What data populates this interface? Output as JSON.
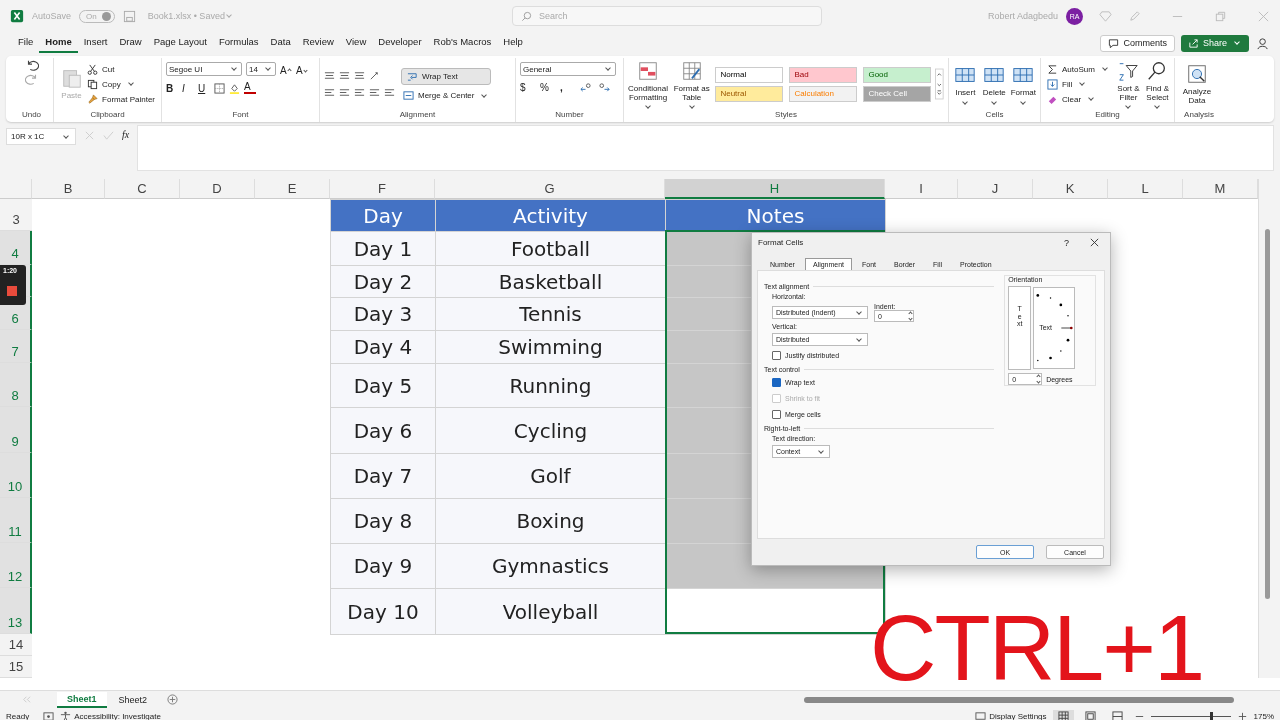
{
  "title_bar": {
    "autosave_label": "AutoSave",
    "autosave_toggle": {
      "label": "On",
      "on": true
    },
    "document": "Book1.xlsx • Saved",
    "search": {
      "placeholder": "Search"
    },
    "user_name": "Robert Adagbedu",
    "avatar": "RA"
  },
  "menu_tabs": [
    {
      "label": "File",
      "selected": false
    },
    {
      "label": "Home",
      "selected": true
    },
    {
      "label": "Insert",
      "selected": false
    },
    {
      "label": "Draw",
      "selected": false
    },
    {
      "label": "Page Layout",
      "selected": false
    },
    {
      "label": "Formulas",
      "selected": false
    },
    {
      "label": "Data",
      "selected": false
    },
    {
      "label": "Review",
      "selected": false
    },
    {
      "label": "View",
      "selected": false
    },
    {
      "label": "Developer",
      "selected": false
    },
    {
      "label": "Rob's Macros",
      "selected": false
    },
    {
      "label": "Help",
      "selected": false
    }
  ],
  "comments_button": "Comments",
  "share_button": "Share",
  "ribbon": {
    "undo_label": "Undo",
    "clipboard": {
      "paste": "Paste",
      "cut": "Cut",
      "copy": "Copy",
      "format_painter": "Format Painter",
      "label": "Clipboard"
    },
    "font": {
      "family": "Segoe UI",
      "size": "14",
      "grow": "A",
      "shrink": "A",
      "bold": "B",
      "italic": "I",
      "underline": "U",
      "font_color": "A",
      "label": "Font"
    },
    "alignment": {
      "wrap_text": {
        "label": "Wrap Text",
        "on": true
      },
      "merge": "Merge & Center",
      "label": "Alignment"
    },
    "number": {
      "format": "General",
      "currency": "$",
      "percent": "%",
      "comma": ",",
      "label": "Number"
    },
    "styles": {
      "conditional": "Conditional Formatting",
      "format_table": "Format as Table",
      "label": "Styles",
      "gallery": [
        {
          "label": "Normal",
          "color": "#ffffff"
        },
        {
          "label": "Bad",
          "color": "#ffc7ce"
        },
        {
          "label": "Good",
          "color": "#c6efce"
        },
        {
          "label": "Neutral",
          "color": "#ffeb9c"
        },
        {
          "label": "Calculation",
          "color": "#f2f2f2"
        },
        {
          "label": "Check Cell",
          "color": "#a5a5a5"
        }
      ]
    },
    "cells": {
      "buttons": [
        "Insert",
        "Delete",
        "Format"
      ],
      "label": "Cells"
    },
    "editing": {
      "autosum": "AutoSum",
      "fill": "Fill",
      "clear": "Clear",
      "sort": "Sort & Filter",
      "find": "Find & Select",
      "label": "Editing"
    },
    "analysis": {
      "analyze": "Analyze Data",
      "label": "Analysis"
    }
  },
  "formula_bar": {
    "name_box": "10R x 1C",
    "fx": "fx"
  },
  "sheet": {
    "columns": [
      {
        "label": "B",
        "selected": false
      },
      {
        "label": "C",
        "selected": false
      },
      {
        "label": "D",
        "selected": false
      },
      {
        "label": "E",
        "selected": false
      },
      {
        "label": "F",
        "selected": false
      },
      {
        "label": "G",
        "selected": false
      },
      {
        "label": "H",
        "selected": true
      },
      {
        "label": "I",
        "selected": false
      },
      {
        "label": "J",
        "selected": false
      },
      {
        "label": "K",
        "selected": false
      },
      {
        "label": "L",
        "selected": false
      },
      {
        "label": "M",
        "selected": false
      }
    ],
    "row_numbers": [
      {
        "label": "3",
        "selected": false
      },
      {
        "label": "4",
        "selected": true
      },
      {
        "selected": true
      },
      {
        "label": "6",
        "selected": true
      },
      {
        "label": "7",
        "selected": true
      },
      {
        "label": "8",
        "selected": true
      },
      {
        "label": "9",
        "selected": true
      },
      {
        "label": "10",
        "selected": true
      },
      {
        "label": "11",
        "selected": true
      },
      {
        "label": "12",
        "selected": true
      },
      {
        "label": "13",
        "selected": true
      },
      {
        "label": "14",
        "selected": false
      },
      {
        "label": "15",
        "selected": false
      }
    ],
    "headers": [
      "Day",
      "Activity",
      "Notes"
    ],
    "rows": [
      {
        "day": "Day 1",
        "activity": "Football",
        "active": false
      },
      {
        "day": "Day 2",
        "activity": "Basketball",
        "active": false
      },
      {
        "day": "Day 3",
        "activity": "Tennis",
        "active": false
      },
      {
        "day": "Day 4",
        "activity": "Swimming",
        "active": false
      },
      {
        "day": "Day 5",
        "activity": "Running",
        "active": false
      },
      {
        "day": "Day 6",
        "activity": "Cycling",
        "active": false
      },
      {
        "day": "Day 7",
        "activity": "Golf",
        "active": false
      },
      {
        "day": "Day 8",
        "activity": "Boxing",
        "active": false
      },
      {
        "day": "Day 9",
        "activity": "Gymnastics",
        "active": false
      },
      {
        "day": "Day 10",
        "activity": "Volleyball",
        "active": true
      }
    ]
  },
  "dialog": {
    "title": "Format Cells",
    "help": "?",
    "tabs": [
      {
        "label": "Number",
        "selected": false
      },
      {
        "label": "Alignment",
        "selected": true
      },
      {
        "label": "Font",
        "selected": false
      },
      {
        "label": "Border",
        "selected": false
      },
      {
        "label": "Fill",
        "selected": false
      },
      {
        "label": "Protection",
        "selected": false
      }
    ],
    "text_alignment": "Text alignment",
    "horizontal": {
      "label": "Horizontal:",
      "value": "Distributed (Indent)"
    },
    "indent": {
      "label": "Indent:",
      "value": "0"
    },
    "vertical": {
      "label": "Vertical:",
      "value": "Distributed"
    },
    "justify": {
      "label": "Justify distributed",
      "checked": false,
      "disabled": false
    },
    "text_control": "Text control",
    "options": [
      {
        "label": "Wrap text",
        "checked": true,
        "disabled": false
      },
      {
        "label": "Shrink to fit",
        "checked": false,
        "disabled": true
      },
      {
        "label": "Merge cells",
        "checked": false,
        "disabled": false
      }
    ],
    "right_to_left": "Right-to-left",
    "text_direction": {
      "label": "Text direction:",
      "value": "Context"
    },
    "orientation": {
      "label": "Orientation",
      "vertical_text": "Text",
      "dial_text": "Text",
      "degrees": "0",
      "degrees_label": "Degrees"
    },
    "ok": "OK",
    "cancel": "Cancel"
  },
  "sheet_tabs": [
    {
      "label": "Sheet1",
      "selected": true
    },
    {
      "label": "Sheet2",
      "selected": false
    }
  ],
  "status_bar": {
    "ready": "Ready",
    "accessibility": "Accessibility: Investigate",
    "display_settings": "Display Settings",
    "zoom_slider": {
      "level": 0.75
    },
    "zoom": "175%"
  },
  "overlay": {
    "shortcut": "CTRL+1",
    "recording_time": "1:20"
  }
}
